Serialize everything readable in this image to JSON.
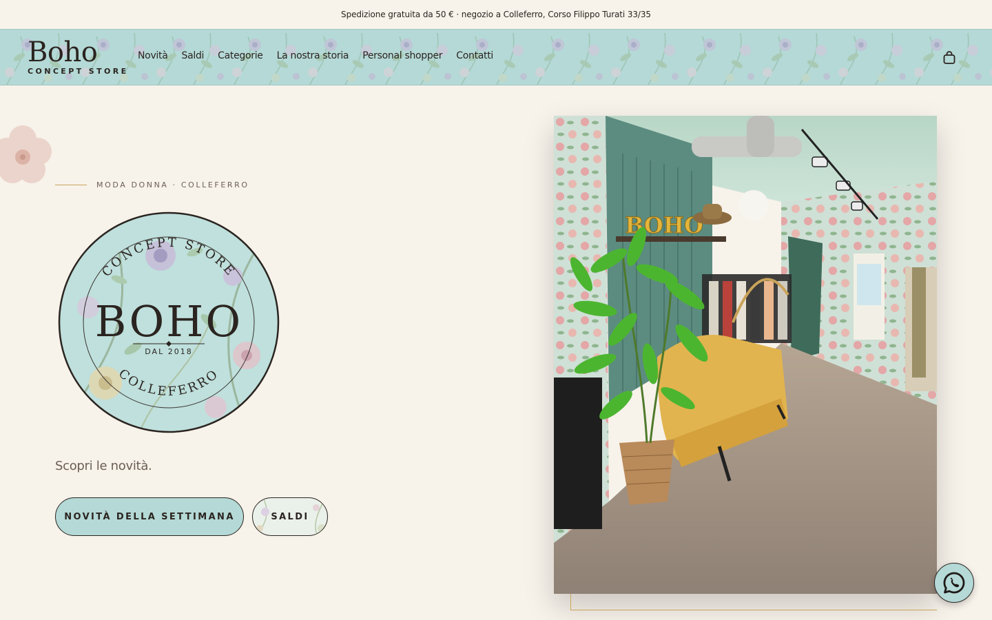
{
  "announcement": {
    "text": "Spedizione gratuita da 50 € · negozio a Colleferro, Corso Filippo Turati 33/35"
  },
  "header": {
    "logo_word": "Boho",
    "logo_sub": "CONCEPT STORE",
    "nav": [
      {
        "label": "Novità"
      },
      {
        "label": "Saldi"
      },
      {
        "label": "Categorie"
      },
      {
        "label": "La nostra storia"
      },
      {
        "label": "Personal shopper"
      },
      {
        "label": "Contatti"
      }
    ],
    "cart_icon": "shopping-bag-icon"
  },
  "hero": {
    "eyebrow": "MODA DONNA · COLLEFERRO",
    "badge": {
      "top_arc": "CONCEPT STORE",
      "name": "BOHO",
      "since": "DAL 2018",
      "bottom_arc": "COLLEFERRO"
    },
    "tagline": "Scopri le novità.",
    "primary_button": "NOVITÀ DELLA SETTIMANA",
    "secondary_button": "SALDI",
    "photo_sign": "BOHO"
  },
  "colors": {
    "background": "#f7f2ea",
    "mint": "#b4d9d6",
    "gold": "#c9a35a",
    "text": "#2b2420"
  },
  "floating": {
    "whatsapp_icon": "whatsapp-icon"
  }
}
